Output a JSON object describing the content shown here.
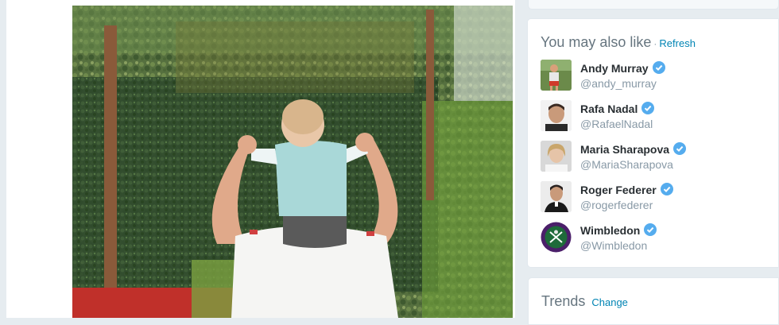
{
  "who_to_follow": {
    "title": "You may also like",
    "separator": "·",
    "refresh_label": "Refresh",
    "users": [
      {
        "name": "Andy Murray",
        "handle": "@andy_murray",
        "avatar": "andy-murray-avatar",
        "verified": true
      },
      {
        "name": "Rafa Nadal",
        "handle": "@RafaelNadal",
        "avatar": "rafa-nadal-avatar",
        "verified": true
      },
      {
        "name": "Maria Sharapova",
        "handle": "@MariaSharapova",
        "avatar": "maria-sharapova-avatar",
        "verified": true
      },
      {
        "name": "Roger Federer",
        "handle": "@rogerfederer",
        "avatar": "roger-federer-avatar",
        "verified": true
      },
      {
        "name": "Wimbledon",
        "handle": "@Wimbledon",
        "avatar": "wimbledon-logo-avatar",
        "verified": true
      }
    ]
  },
  "trends": {
    "title": "Trends",
    "change_label": "Change"
  },
  "colors": {
    "background": "#e6ecf0",
    "link": "#0084b4",
    "verified_badge": "#55acee",
    "name_text": "#292f33",
    "secondary_text": "#8899a6"
  }
}
